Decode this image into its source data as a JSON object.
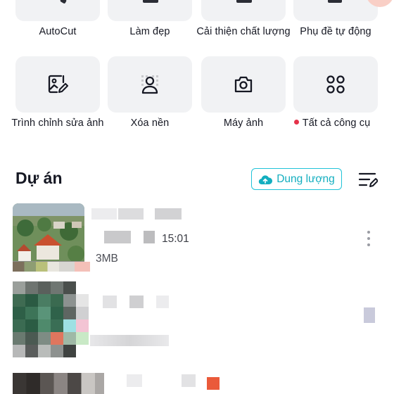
{
  "tools_row1": [
    {
      "label": "AutoCut"
    },
    {
      "label": "Làm đẹp"
    },
    {
      "label": "Cải thiện chất lượng"
    },
    {
      "label": "Phụ đề tự động"
    }
  ],
  "tools_row2": [
    {
      "label": "Trình chỉnh sửa ảnh",
      "icon": "photo-edit-icon"
    },
    {
      "label": "Xóa nền",
      "icon": "remove-background-icon"
    },
    {
      "label": "Máy ảnh",
      "icon": "camera-icon"
    },
    {
      "label": "Tất cả công cụ",
      "icon": "all-tools-icon",
      "badge": "red-dot"
    }
  ],
  "projects": {
    "title": "Dự án",
    "storage_label": "Dung lượng",
    "items": [
      {
        "time": "15:01",
        "size": "3MB"
      }
    ]
  },
  "colors": {
    "accent": "#20c3d8",
    "text": "#161823",
    "tile_bg": "#f1f2f4",
    "badge": "#e5324a"
  }
}
